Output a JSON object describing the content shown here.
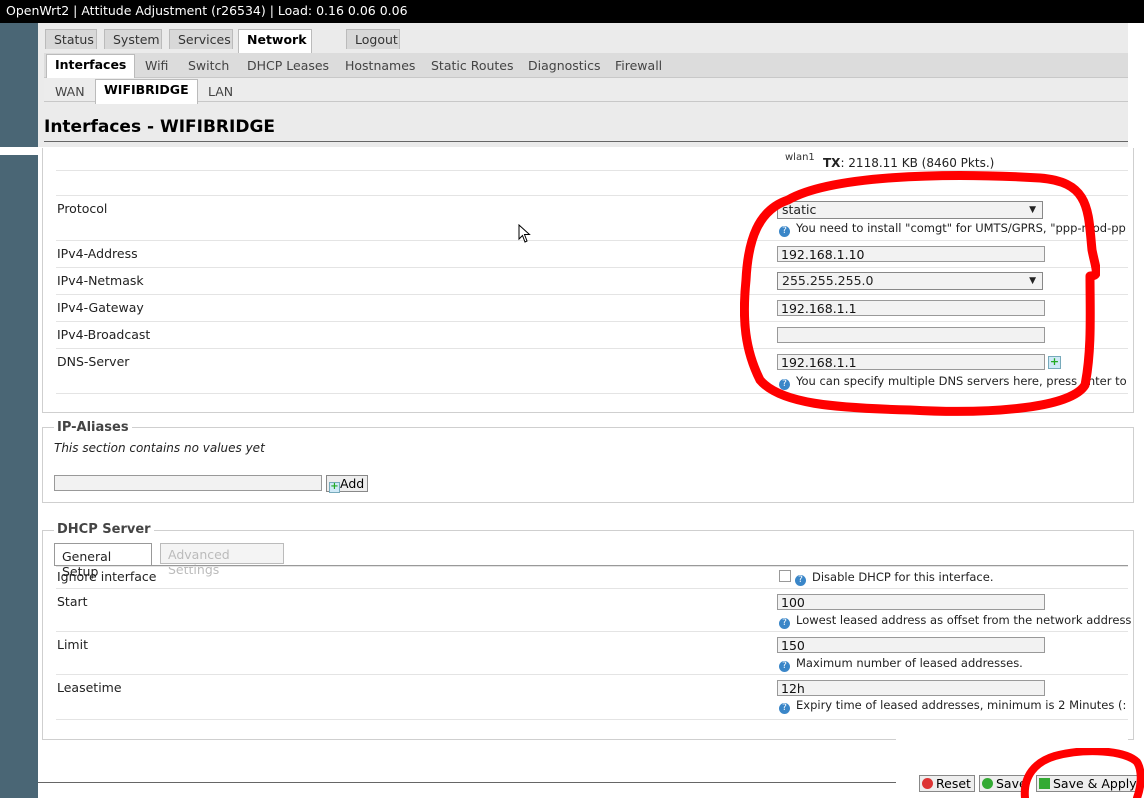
{
  "titlebar": {
    "text": "OpenWrt2 | Attitude Adjustment (r26534) | Load: 0.16 0.06 0.06"
  },
  "main_tabs": [
    "Status",
    "System",
    "Services",
    "Network",
    "Logout"
  ],
  "sub_tabs": [
    "Interfaces",
    "Wifi",
    "Switch",
    "DHCP Leases",
    "Hostnames",
    "Static Routes",
    "Diagnostics",
    "Firewall"
  ],
  "iface_tabs": [
    "WAN",
    "WIFIBRIDGE",
    "LAN"
  ],
  "page_title": "Interfaces - WIFIBRIDGE",
  "status": {
    "dev": "wlan1",
    "tx_label": "TX",
    "tx_value": ": 2118.11 KB (8460 Pkts.)"
  },
  "general": {
    "protocol_label": "Protocol",
    "protocol_value": "static",
    "protocol_help": "You need to install \"comgt\" for UMTS/GPRS, \"ppp-mod-pp",
    "ipv4_address_label": "IPv4-Address",
    "ipv4_address_value": "192.168.1.10",
    "ipv4_netmask_label": "IPv4-Netmask",
    "ipv4_netmask_value": "255.255.255.0",
    "ipv4_gateway_label": "IPv4-Gateway",
    "ipv4_gateway_value": "192.168.1.1",
    "ipv4_broadcast_label": "IPv4-Broadcast",
    "ipv4_broadcast_value": "",
    "dns_label": "DNS-Server",
    "dns_value": "192.168.1.1",
    "dns_help": "You can specify multiple DNS servers here, press enter to"
  },
  "ip_aliases": {
    "legend": "IP-Aliases",
    "empty_text": "This section contains no values yet",
    "add_value": "",
    "add_label": "Add"
  },
  "dhcp": {
    "legend": "DHCP Server",
    "tabs": [
      "General Setup",
      "Advanced Settings"
    ],
    "ignore_label": "Ignore interface",
    "ignore_help": "Disable DHCP for this interface.",
    "start_label": "Start",
    "start_value": "100",
    "start_help": "Lowest leased address as offset from the network address",
    "limit_label": "Limit",
    "limit_value": "150",
    "limit_help": "Maximum number of leased addresses.",
    "leasetime_label": "Leasetime",
    "leasetime_value": "12h",
    "leasetime_help": "Expiry time of leased addresses, minimum is 2 Minutes (:"
  },
  "actions": {
    "reset": "Reset",
    "save": "Save",
    "save_apply": "Save & Apply"
  },
  "colors": {
    "accent_red": "#ff0000",
    "slate": "#4a6675"
  }
}
